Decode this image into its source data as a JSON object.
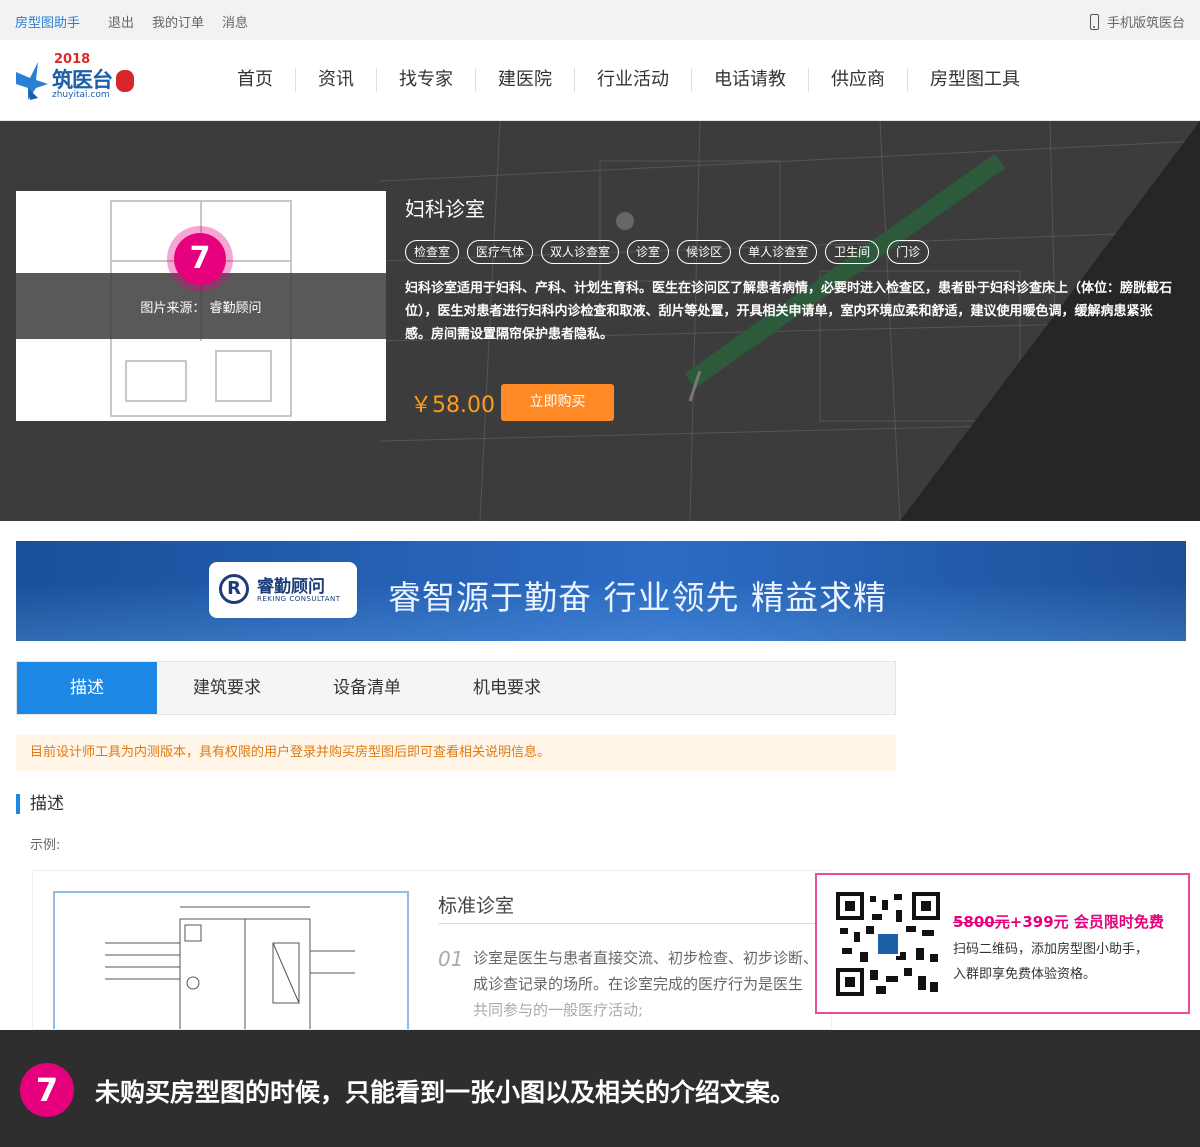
{
  "topbar": {
    "brand": "房型图助手",
    "links": [
      "退出",
      "我的订单",
      "消息"
    ],
    "mobile": "手机版筑医台"
  },
  "logo": {
    "year": "2018",
    "name": "筑医台",
    "url": "zhuyitai.com"
  },
  "nav": [
    "首页",
    "资讯",
    "找专家",
    "建医院",
    "行业活动",
    "电话请教",
    "供应商",
    "房型图工具"
  ],
  "product": {
    "image_caption": "图片来源：  睿勤顾问",
    "step": "7",
    "title": "妇科诊室",
    "tags": [
      "检查室",
      "医疗气体",
      "双人诊查室",
      "诊室",
      "候诊区",
      "单人诊查室",
      "卫生间",
      "门诊"
    ],
    "description": "妇科诊室适用于妇科、产科、计划生育科。医生在诊问区了解患者病情，必要时进入检查区，患者卧于妇科诊查床上（体位：膀胱截石位），医生对患者进行妇科内诊检查和取液、刮片等处置，开具相关申请单，室内环境应柔和舒适，建议使用暖色调，缓解病患紧张感。房间需设置隔帘保护患者隐私。",
    "price": "￥58.00",
    "buy_label": "立即购买"
  },
  "banner": {
    "company_cn": "睿勤顾问",
    "company_en": "REKING CONSULTANT",
    "slogan": "睿智源于勤奋  行业领先  精益求精"
  },
  "tabs": [
    "描述",
    "建筑要求",
    "设备清单",
    "机电要求"
  ],
  "notice": "目前设计师工具为内测版本，具有权限的用户登录并购买房型图后即可查看相关说明信息。",
  "section": {
    "title": "描述",
    "example_label": "示例:"
  },
  "example": {
    "title": "标准诊室",
    "num": "01",
    "text_main": "诊室是医生与患者直接交流、初步检查、初步诊断、成诊查记录的场所。在诊室完成的医疗行为是医生",
    "text_faded": "共同参与的一般医疗活动;"
  },
  "qr_popup": {
    "price_old": "5800元",
    "price_extra": "+399元",
    "promo": "会员限时免费",
    "line1": "扫码二维码，添加房型图小助手，",
    "line2": "入群即享免费体验资格。"
  },
  "footer": {
    "step": "7",
    "caption": "未购买房型图的时候，只能看到一张小图以及相关的介绍文案。"
  },
  "colors": {
    "accent": "#1e88e5",
    "buy": "#ff8a25",
    "badge": "#e6007e",
    "price": "#ff9c1a"
  }
}
